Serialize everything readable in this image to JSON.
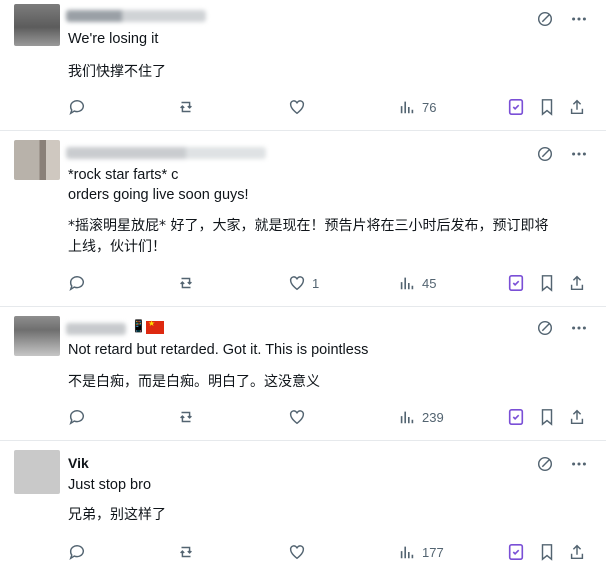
{
  "posts": [
    {
      "name": "",
      "lines": [
        "We're losing it"
      ],
      "translation": [
        "我们快撑不住了"
      ],
      "counts": {
        "replies": "",
        "reposts": "",
        "likes": "",
        "views": "76"
      }
    },
    {
      "name": "",
      "lines": [
        "*rock star farts* c",
        "orders going live soon guys!"
      ],
      "translation": [
        "*摇滚明星放屁* 好了，大家，就是现在！预告片将在三小时后发布，预订即将",
        "上线，伙计们！"
      ],
      "counts": {
        "replies": "",
        "reposts": "",
        "likes": "1",
        "views": "45"
      }
    },
    {
      "name": "",
      "lines": [
        "Not retard but retarded. Got it. This is pointless"
      ],
      "translation": [
        "不是白痴，而是白痴。明白了。这没意义"
      ],
      "counts": {
        "replies": "",
        "reposts": "",
        "likes": "",
        "views": "239"
      }
    },
    {
      "name": "Vik",
      "lines": [
        "Just stop bro"
      ],
      "translation": [
        "兄弟，别这样了"
      ],
      "counts": {
        "replies": "",
        "reposts": "",
        "likes": "",
        "views": "177"
      }
    }
  ],
  "colors": {
    "text": "#0f1419",
    "muted": "#536471",
    "highlight": "#7a4fd6",
    "divider": "#e6e9ec"
  },
  "icons": [
    "reply-icon",
    "repost-icon",
    "like-icon",
    "views-icon",
    "grok-icon",
    "bookmark-icon",
    "share-icon",
    "edit-icon",
    "more-icon"
  ]
}
